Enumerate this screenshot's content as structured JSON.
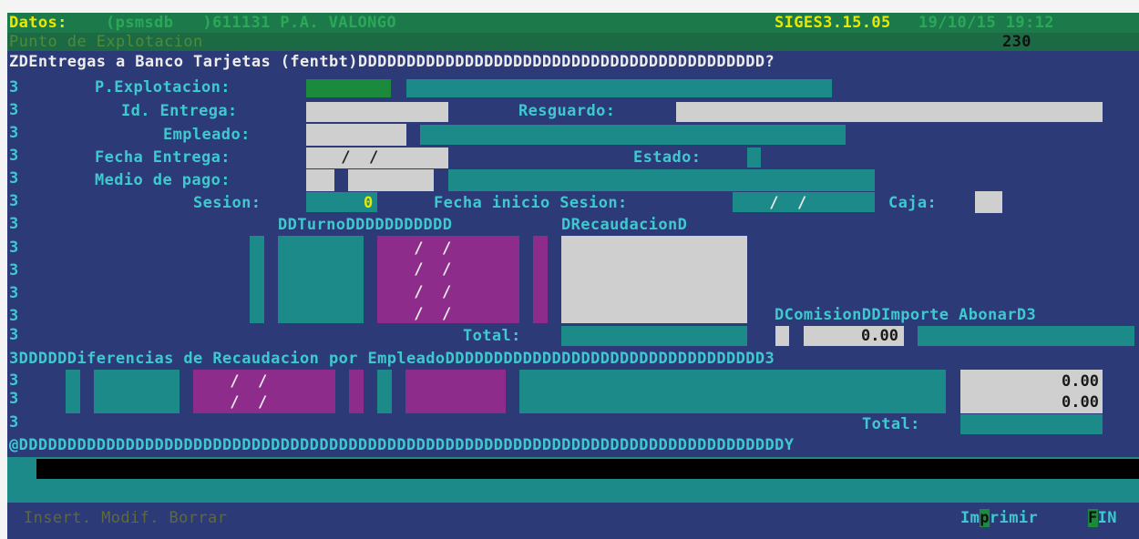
{
  "header": {
    "datos_label": "Datos:",
    "datos_value": "(psmsdb   )611131 P.A. VALONGO",
    "version": "SIGES3.15.05",
    "datetime": "19/10/15 19:12",
    "subtitle": "Punto de Explotacion",
    "code": "230"
  },
  "form": {
    "border_top": "ZDEntregas a Banco Tarjetas (fentbt)DDDDDDDDDDDDDDDDDDDDDDDDDDDDDDDDDDDDDDDDDD?",
    "side_char": "3",
    "p_explotacion_label": "P.Explotacion:",
    "id_entrega_label": "Id. Entrega:",
    "resguardo_label": "Resguardo:",
    "empleado_label": "Empleado:",
    "fecha_entrega_label": "Fecha Entrega:",
    "fecha_entrega_value": " /  /",
    "estado_label": "Estado:",
    "medio_pago_label": "Medio de pago:",
    "sesion_label": "Sesion:",
    "sesion_value": "0",
    "fecha_inicio_label": "Fecha inicio Sesion:",
    "fecha_inicio_value": " /  /",
    "caja_label": "Caja:",
    "turno_header": "DDTurnoDDDDDDDDDDD",
    "recaudacion_header": "DRecaudacionD",
    "turno_dates": [
      " /  /",
      " /  /",
      " /  /",
      " /  /"
    ],
    "comision_header": "DComisionDDImporte AbonarD3",
    "total_label": "Total:",
    "importe_value": "0.00",
    "diferencias_header": "3DDDDDDiferencias de Recaudacion por EmpleadoDDDDDDDDDDDDDDDDDDDDDDDDDDDDDDDDD3",
    "dif_dates": [
      " /  /",
      " /  /"
    ],
    "dif_values": [
      "0.00",
      "0.00"
    ],
    "total2_label": "Total:",
    "border_bottom": "@DDDDDDDDDDDDDDDDDDDDDDDDDDDDDDDDDDDDDDDDDDDDDDDDDDDDDDDDDDDDDDDDDDDDDDDDDDDDDDDY"
  },
  "footer": {
    "actions": "Insert. Modif. Borrar",
    "imprimir_pre": "Im",
    "imprimir_hot": "p",
    "imprimir_post": "rimir ",
    "fin_hot": "F",
    "fin_post": "IN"
  },
  "colors": {
    "background": "#2d3a78",
    "teal": "#1c8a88",
    "gray": "#cfcfcf",
    "purple": "#8e2c8c",
    "green": "#1c8a3c"
  }
}
